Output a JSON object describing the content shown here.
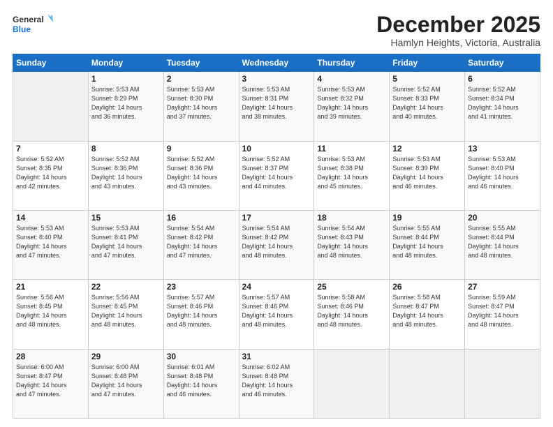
{
  "header": {
    "logo_line1": "General",
    "logo_line2": "Blue",
    "title": "December 2025",
    "subtitle": "Hamlyn Heights, Victoria, Australia"
  },
  "weekdays": [
    "Sunday",
    "Monday",
    "Tuesday",
    "Wednesday",
    "Thursday",
    "Friday",
    "Saturday"
  ],
  "weeks": [
    [
      {
        "day": "",
        "info": ""
      },
      {
        "day": "1",
        "info": "Sunrise: 5:53 AM\nSunset: 8:29 PM\nDaylight: 14 hours\nand 36 minutes."
      },
      {
        "day": "2",
        "info": "Sunrise: 5:53 AM\nSunset: 8:30 PM\nDaylight: 14 hours\nand 37 minutes."
      },
      {
        "day": "3",
        "info": "Sunrise: 5:53 AM\nSunset: 8:31 PM\nDaylight: 14 hours\nand 38 minutes."
      },
      {
        "day": "4",
        "info": "Sunrise: 5:53 AM\nSunset: 8:32 PM\nDaylight: 14 hours\nand 39 minutes."
      },
      {
        "day": "5",
        "info": "Sunrise: 5:52 AM\nSunset: 8:33 PM\nDaylight: 14 hours\nand 40 minutes."
      },
      {
        "day": "6",
        "info": "Sunrise: 5:52 AM\nSunset: 8:34 PM\nDaylight: 14 hours\nand 41 minutes."
      }
    ],
    [
      {
        "day": "7",
        "info": "Sunrise: 5:52 AM\nSunset: 8:35 PM\nDaylight: 14 hours\nand 42 minutes."
      },
      {
        "day": "8",
        "info": "Sunrise: 5:52 AM\nSunset: 8:36 PM\nDaylight: 14 hours\nand 43 minutes."
      },
      {
        "day": "9",
        "info": "Sunrise: 5:52 AM\nSunset: 8:36 PM\nDaylight: 14 hours\nand 43 minutes."
      },
      {
        "day": "10",
        "info": "Sunrise: 5:52 AM\nSunset: 8:37 PM\nDaylight: 14 hours\nand 44 minutes."
      },
      {
        "day": "11",
        "info": "Sunrise: 5:53 AM\nSunset: 8:38 PM\nDaylight: 14 hours\nand 45 minutes."
      },
      {
        "day": "12",
        "info": "Sunrise: 5:53 AM\nSunset: 8:39 PM\nDaylight: 14 hours\nand 46 minutes."
      },
      {
        "day": "13",
        "info": "Sunrise: 5:53 AM\nSunset: 8:40 PM\nDaylight: 14 hours\nand 46 minutes."
      }
    ],
    [
      {
        "day": "14",
        "info": "Sunrise: 5:53 AM\nSunset: 8:40 PM\nDaylight: 14 hours\nand 47 minutes."
      },
      {
        "day": "15",
        "info": "Sunrise: 5:53 AM\nSunset: 8:41 PM\nDaylight: 14 hours\nand 47 minutes."
      },
      {
        "day": "16",
        "info": "Sunrise: 5:54 AM\nSunset: 8:42 PM\nDaylight: 14 hours\nand 47 minutes."
      },
      {
        "day": "17",
        "info": "Sunrise: 5:54 AM\nSunset: 8:42 PM\nDaylight: 14 hours\nand 48 minutes."
      },
      {
        "day": "18",
        "info": "Sunrise: 5:54 AM\nSunset: 8:43 PM\nDaylight: 14 hours\nand 48 minutes."
      },
      {
        "day": "19",
        "info": "Sunrise: 5:55 AM\nSunset: 8:44 PM\nDaylight: 14 hours\nand 48 minutes."
      },
      {
        "day": "20",
        "info": "Sunrise: 5:55 AM\nSunset: 8:44 PM\nDaylight: 14 hours\nand 48 minutes."
      }
    ],
    [
      {
        "day": "21",
        "info": "Sunrise: 5:56 AM\nSunset: 8:45 PM\nDaylight: 14 hours\nand 48 minutes."
      },
      {
        "day": "22",
        "info": "Sunrise: 5:56 AM\nSunset: 8:45 PM\nDaylight: 14 hours\nand 48 minutes."
      },
      {
        "day": "23",
        "info": "Sunrise: 5:57 AM\nSunset: 8:46 PM\nDaylight: 14 hours\nand 48 minutes."
      },
      {
        "day": "24",
        "info": "Sunrise: 5:57 AM\nSunset: 8:46 PM\nDaylight: 14 hours\nand 48 minutes."
      },
      {
        "day": "25",
        "info": "Sunrise: 5:58 AM\nSunset: 8:46 PM\nDaylight: 14 hours\nand 48 minutes."
      },
      {
        "day": "26",
        "info": "Sunrise: 5:58 AM\nSunset: 8:47 PM\nDaylight: 14 hours\nand 48 minutes."
      },
      {
        "day": "27",
        "info": "Sunrise: 5:59 AM\nSunset: 8:47 PM\nDaylight: 14 hours\nand 48 minutes."
      }
    ],
    [
      {
        "day": "28",
        "info": "Sunrise: 6:00 AM\nSunset: 8:47 PM\nDaylight: 14 hours\nand 47 minutes."
      },
      {
        "day": "29",
        "info": "Sunrise: 6:00 AM\nSunset: 8:48 PM\nDaylight: 14 hours\nand 47 minutes."
      },
      {
        "day": "30",
        "info": "Sunrise: 6:01 AM\nSunset: 8:48 PM\nDaylight: 14 hours\nand 46 minutes."
      },
      {
        "day": "31",
        "info": "Sunrise: 6:02 AM\nSunset: 8:48 PM\nDaylight: 14 hours\nand 46 minutes."
      },
      {
        "day": "",
        "info": ""
      },
      {
        "day": "",
        "info": ""
      },
      {
        "day": "",
        "info": ""
      }
    ]
  ]
}
